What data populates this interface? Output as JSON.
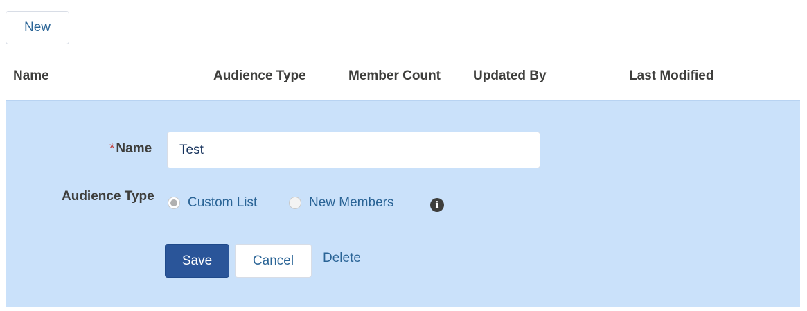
{
  "toolbar": {
    "new_label": "New"
  },
  "table": {
    "columns": [
      "Name",
      "Audience Type",
      "Member Count",
      "Updated By",
      "Last Modified"
    ]
  },
  "form": {
    "name_label": "Name",
    "required_marker": "*",
    "name_value": "Test",
    "audience_type_label": "Audience Type",
    "audience_options": [
      {
        "label": "Custom List",
        "checked": true
      },
      {
        "label": "New Members",
        "checked": false
      }
    ],
    "info_icon_glyph": "i",
    "info_icon": "info-icon",
    "save_label": "Save",
    "cancel_label": "Cancel",
    "delete_label": "Delete"
  },
  "colors": {
    "panel_background": "#cae1fa",
    "primary_button": "#2a5599",
    "link": "#2a6496",
    "required": "#c23934"
  }
}
